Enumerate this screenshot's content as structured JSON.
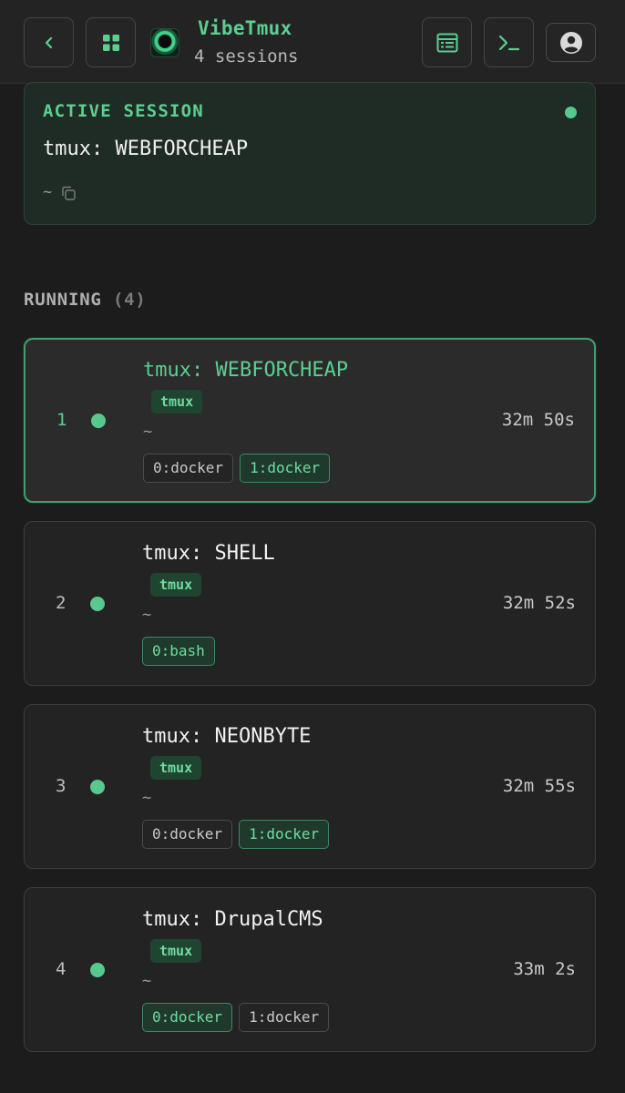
{
  "app": {
    "title": "VibeTmux",
    "session_count": "4 sessions"
  },
  "header": {
    "icons": {
      "back": "chevron-left-icon",
      "grid": "grid-icon",
      "sessions_view": "table-icon",
      "terminal": "terminal-icon",
      "account": "user-circle-icon"
    }
  },
  "active_session": {
    "heading": "ACTIVE SESSION",
    "name": "tmux: WEBFORCHEAP",
    "path": "~",
    "status_color": "#57c98c"
  },
  "running": {
    "label": "RUNNING",
    "count": "(4)"
  },
  "sessions": [
    {
      "index": "1",
      "name": "tmux: WEBFORCHEAP",
      "type": "tmux",
      "path": "~",
      "uptime": "32m 50s",
      "windows": [
        {
          "label": "0:docker",
          "active": false
        },
        {
          "label": "1:docker",
          "active": true
        }
      ]
    },
    {
      "index": "2",
      "name": "tmux: SHELL",
      "type": "tmux",
      "path": "~",
      "uptime": "32m 52s",
      "windows": [
        {
          "label": "0:bash",
          "active": true
        }
      ]
    },
    {
      "index": "3",
      "name": "tmux: NEONBYTE",
      "type": "tmux",
      "path": "~",
      "uptime": "32m 55s",
      "windows": [
        {
          "label": "0:docker",
          "active": false
        },
        {
          "label": "1:docker",
          "active": true
        }
      ]
    },
    {
      "index": "4",
      "name": "tmux: DrupalCMS",
      "type": "tmux",
      "path": "~",
      "uptime": "33m 2s",
      "windows": [
        {
          "label": "0:docker",
          "active": true
        },
        {
          "label": "1:docker",
          "active": false
        }
      ]
    }
  ],
  "colors": {
    "accent": "#5ccf8f",
    "background": "#1c1c1c",
    "card": "#232323",
    "selected_border": "#3f9e6c"
  }
}
